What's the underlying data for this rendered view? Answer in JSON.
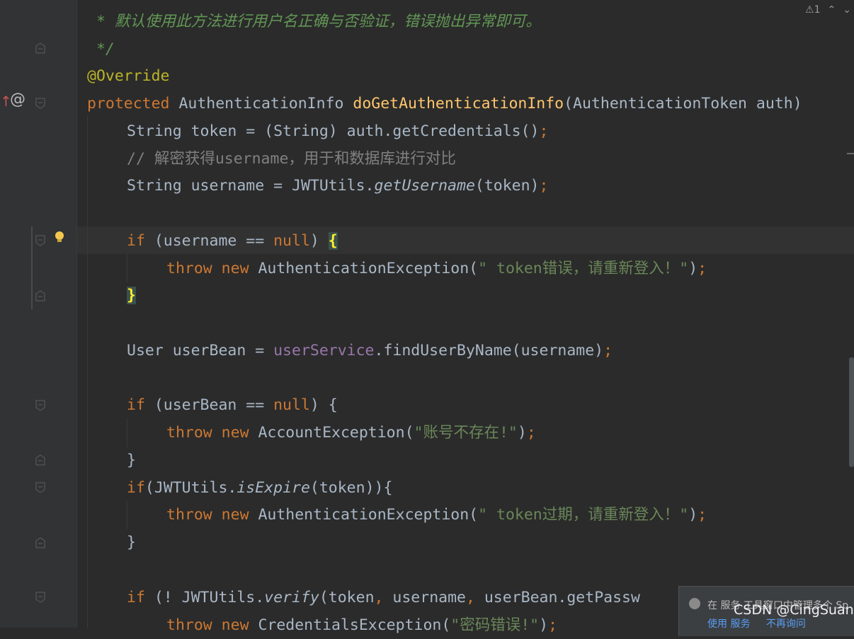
{
  "toolbar": {
    "warning_count": "1"
  },
  "code": {
    "l1_star": " * ",
    "l1_text": "默认使用此方法进行用户名正确与否验证，错误抛出异常即可。",
    "l2": " */",
    "l3": "@Override",
    "l4_kw": "protected",
    "l4_type": " AuthenticationInfo ",
    "l4_fn": "doGetAuthenticationInfo",
    "l4_rest": "(AuthenticationToken auth)",
    "l5_a": "String token = (String) auth.getCredentials()",
    "l5_semi": ";",
    "l6": "// 解密获得username，用于和数据库进行对比",
    "l7_a": "String username = JWTUtils.",
    "l7_m": "getUsername",
    "l7_b": "(token)",
    "l7_semi": ";",
    "l9_kw": "if",
    "l9_a": " (username == ",
    "l9_null": "null",
    "l9_b": ") ",
    "l9_brace": "{",
    "l10_throw": "throw",
    "l10_new": " new",
    "l10_a": " AuthenticationException(",
    "l10_str": "\" token错误，请重新登入！\"",
    "l10_b": ")",
    "l10_semi": ";",
    "l11_brace": "}",
    "l13_a": "User userBean = ",
    "l13_f": "userService",
    "l13_b": ".findUserByName(username)",
    "l13_semi": ";",
    "l15_kw": "if",
    "l15_a": " (userBean == ",
    "l15_null": "null",
    "l15_b": ") {",
    "l16_throw": "throw",
    "l16_new": " new",
    "l16_a": " AccountException(",
    "l16_str": "\"账号不存在!\"",
    "l16_b": ")",
    "l16_semi": ";",
    "l17": "}",
    "l18_kw": "if",
    "l18_a": "(JWTUtils.",
    "l18_m": "isExpire",
    "l18_b": "(token)){",
    "l19_throw": "throw",
    "l19_new": " new",
    "l19_a": " AuthenticationException(",
    "l19_str": "\" token过期，请重新登入！\"",
    "l19_b": ")",
    "l19_semi": ";",
    "l20": "}",
    "l22_kw": "if",
    "l22_a": " (! JWTUtils.",
    "l22_m": "verify",
    "l22_b": "(token",
    "l22_c1": ",",
    "l22_c": " username",
    "l22_c2": ",",
    "l22_d": " userBean.getPassw",
    "l23_throw": "throw",
    "l23_new": " new",
    "l23_a": " CredentialsException(",
    "l23_str": "\"密码错误!\"",
    "l23_b": ")",
    "l23_semi": ";"
  },
  "popup": {
    "message": "在 服务 工具窗口中管理多个 Sp",
    "link1": "使用 服务",
    "link2": "不再询问"
  },
  "watermark": "CSDN @CingSuan"
}
